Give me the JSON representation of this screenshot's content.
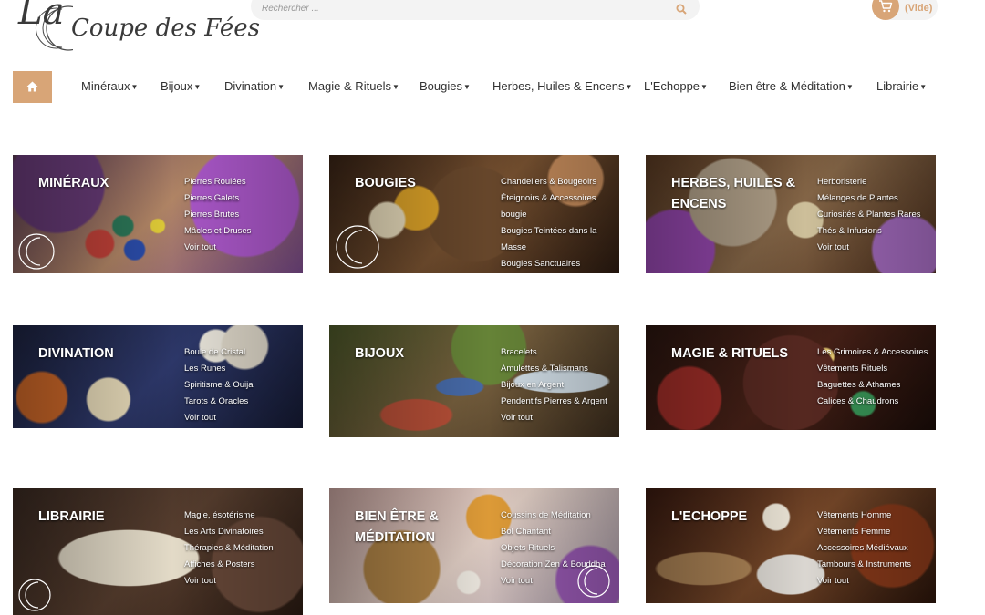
{
  "header": {
    "logo_text_big": "La",
    "logo_text": "Coupe des Fées",
    "search_placeholder": "Rechercher ...",
    "cart_label": "(Vide)",
    "icons": {
      "search": "search-icon",
      "cart": "cart-icon",
      "home": "home-icon"
    }
  },
  "nav": {
    "items": [
      {
        "label": "Minéraux"
      },
      {
        "label": "Bijoux"
      },
      {
        "label": "Divination"
      },
      {
        "label": "Magie & Rituels"
      },
      {
        "label": "Bougies"
      },
      {
        "label": "Herbes, Huiles & Encens"
      },
      {
        "label": "L'Echoppe"
      },
      {
        "label": "Bien être & Méditation"
      },
      {
        "label": "Librairie"
      }
    ]
  },
  "categories": [
    {
      "title": "MINÉRAUX",
      "links": [
        "Pierres Roulées",
        "Pierres Galets",
        "Pierres Brutes",
        "Mâcles et Druses",
        "Voir tout"
      ]
    },
    {
      "title": "BOUGIES",
      "links": [
        "Chandeliers & Bougeoirs",
        "Éteignoirs & Accessoires bougie",
        "Bougies Teintées dans la Masse",
        "Bougies Sanctuaires"
      ]
    },
    {
      "title": "HERBES, HUILES & ENCENS",
      "links": [
        "Herboristerie",
        "Mélanges de Plantes",
        "Curiosités & Plantes Rares",
        "Thés & Infusions",
        "Voir tout"
      ]
    },
    {
      "title": "DIVINATION",
      "links": [
        "Boule de Cristal",
        "Les Runes",
        "Spiritisme & Ouija",
        "Tarots & Oracles",
        "Voir tout"
      ]
    },
    {
      "title": "BIJOUX",
      "links": [
        "Bracelets",
        "Amulettes & Talismans",
        "Bijoux en Argent",
        "Pendentifs Pierres & Argent",
        "Voir tout"
      ]
    },
    {
      "title": "MAGIE & RITUELS",
      "links": [
        "Les Grimoires & Accessoires",
        "Vêtements Rituels",
        "Baguettes & Athames",
        "Calices & Chaudrons"
      ]
    },
    {
      "title": "LIBRAIRIE",
      "links": [
        "Magie, ésotérisme",
        "Les Arts Divinatoires",
        "Thérapies & Méditation",
        "Affiches & Posters",
        "Voir tout"
      ]
    },
    {
      "title": "BIEN ÊTRE & MÉDITATION",
      "links": [
        "Coussins de Méditation",
        "Bol Chantant",
        "Objets Rituels",
        "Décoration Zen & Bouddha",
        "Voir tout"
      ]
    },
    {
      "title": "L'ECHOPPE",
      "links": [
        "Vêtements Homme",
        "Vêtements Femme",
        "Accessoires Médiévaux",
        "Tambours & Instruments",
        "Voir tout"
      ]
    }
  ],
  "colors": {
    "accent": "#d8a577",
    "nav_text": "#333333",
    "search_bg": "#f3f3f3"
  }
}
